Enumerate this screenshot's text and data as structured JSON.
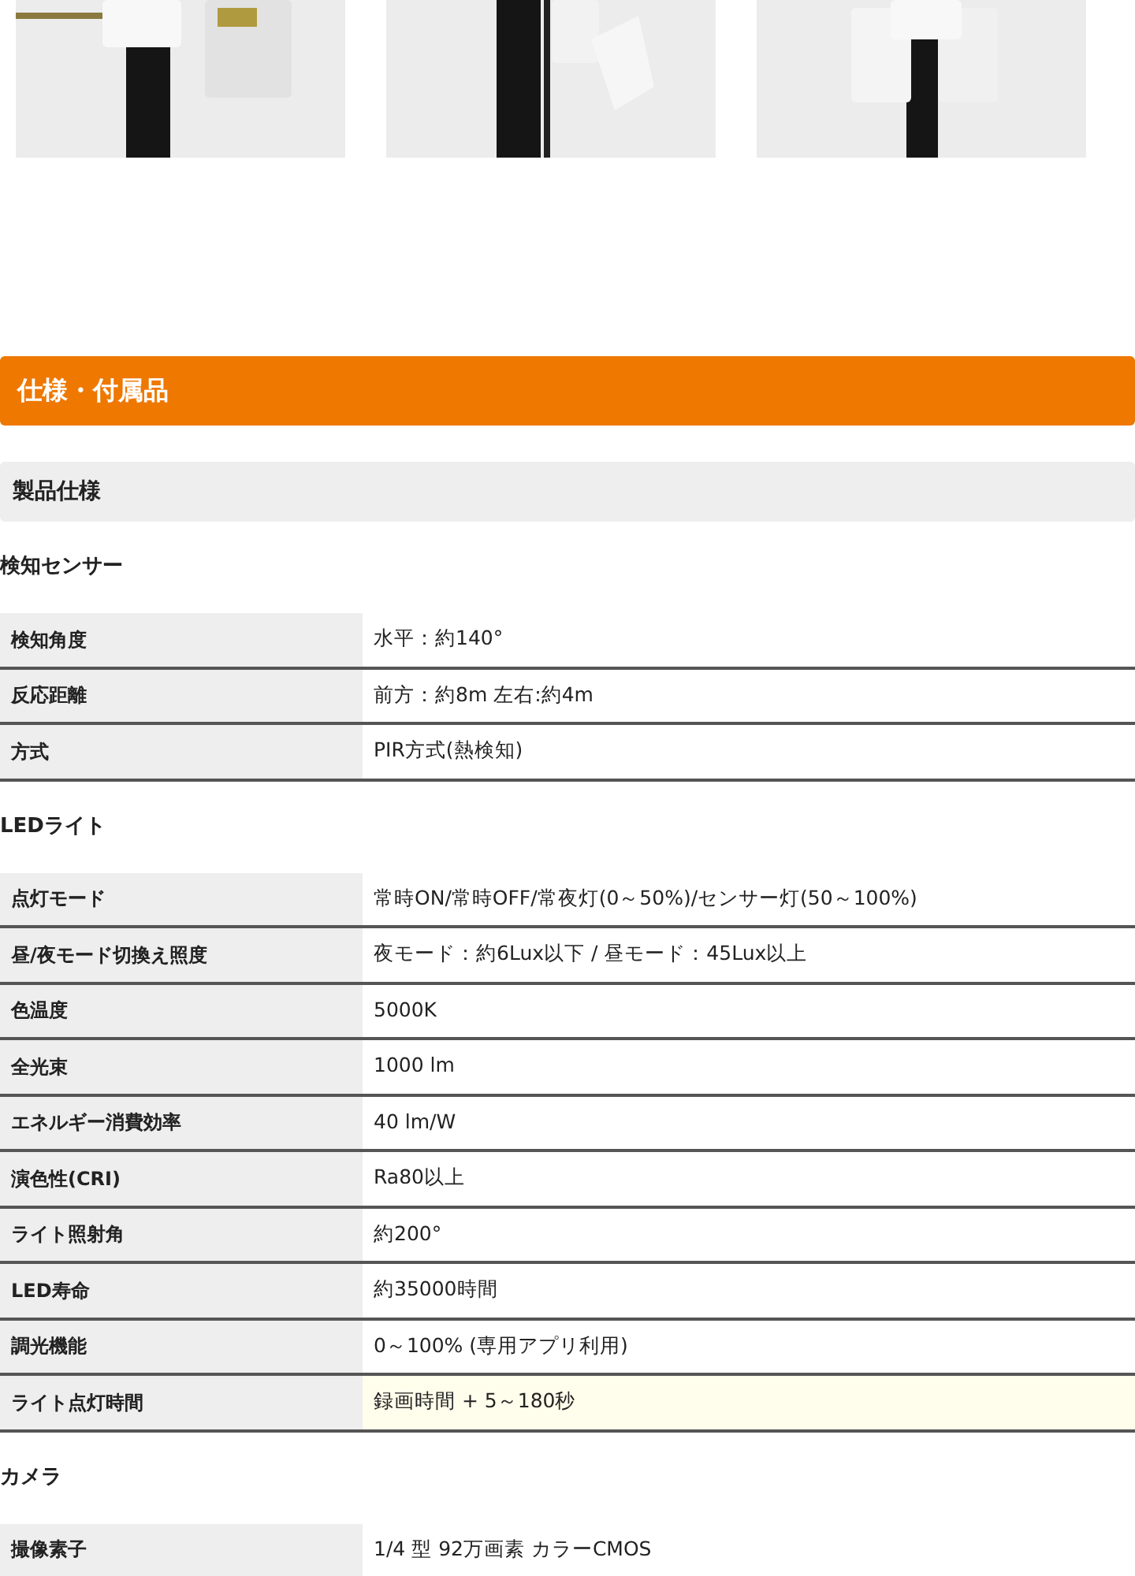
{
  "banner": {
    "title": "仕様・付属品"
  },
  "subheader": {
    "title": "製品仕様"
  },
  "sections": [
    {
      "title": "検知センサー",
      "rows": [
        {
          "label": "検知角度",
          "value": "水平：約140°",
          "highlighted": false
        },
        {
          "label": "反応距離",
          "value": "前方：約8m 左右:約4m",
          "highlighted": false
        },
        {
          "label": "方式",
          "value": "PIR方式(熱検知)",
          "highlighted": false
        }
      ]
    },
    {
      "title": "LEDライト",
      "rows": [
        {
          "label": "点灯モード",
          "value": "常時ON/常時OFF/常夜灯(0～50%)/センサー灯(50～100%)",
          "highlighted": false
        },
        {
          "label": "昼/夜モード切換え照度",
          "value": "夜モード：約6Lux以下 / 昼モード：45Lux以上",
          "highlighted": false
        },
        {
          "label": "色温度",
          "value": "5000K",
          "highlighted": false
        },
        {
          "label": "全光束",
          "value": "1000 lm",
          "highlighted": false
        },
        {
          "label": "エネルギー消費効率",
          "value": "40 lm/W",
          "highlighted": false
        },
        {
          "label": "演色性(CRI)",
          "value": "Ra80以上",
          "highlighted": false
        },
        {
          "label": "ライト照射角",
          "value": "約200°",
          "highlighted": false
        },
        {
          "label": "LED寿命",
          "value": "約35000時間",
          "highlighted": false
        },
        {
          "label": "調光機能",
          "value": "0～100% (専用アプリ利用)",
          "highlighted": false
        },
        {
          "label": "ライト点灯時間",
          "value": "録画時間 + 5～180秒",
          "highlighted": true
        }
      ]
    },
    {
      "title": "カメラ",
      "rows": [
        {
          "label": "撮像素子",
          "value": "1/4 型 92万画素 カラーCMOS",
          "highlighted": false
        }
      ]
    }
  ]
}
